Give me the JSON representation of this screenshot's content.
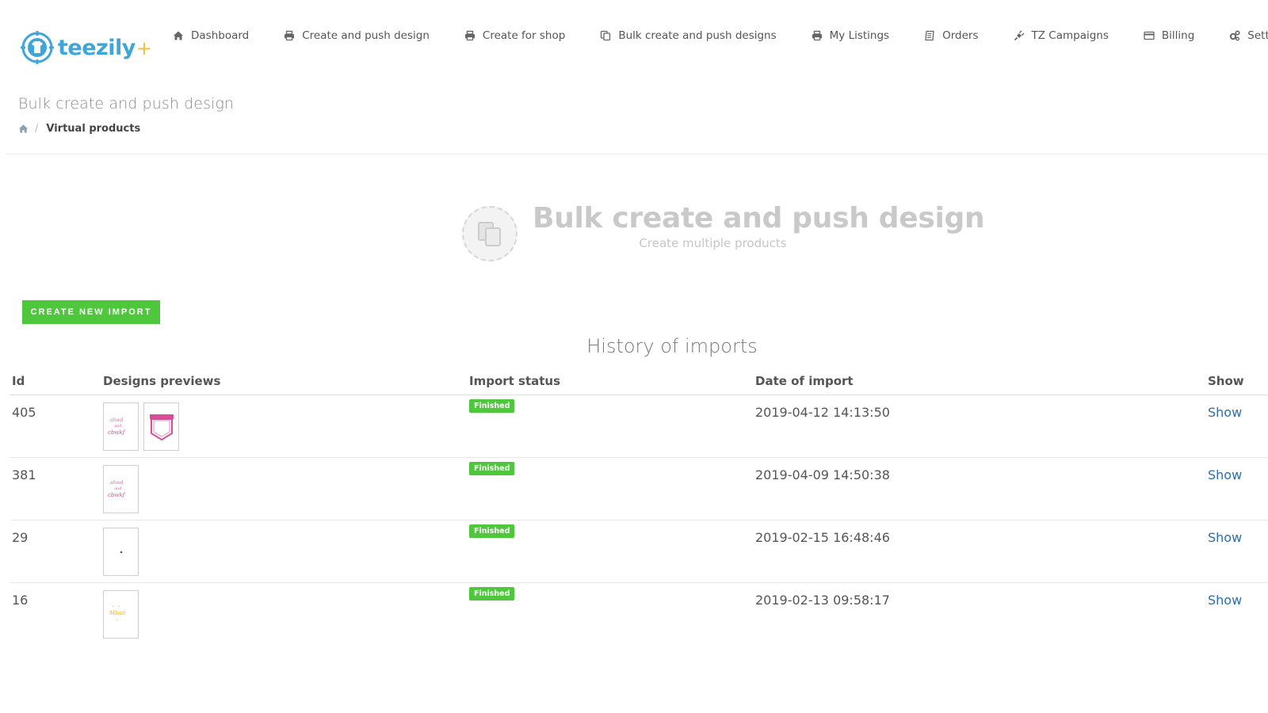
{
  "logo": {
    "text": "teezily",
    "plus": "+"
  },
  "nav": [
    {
      "label": "Dashboard",
      "icon": "home-icon"
    },
    {
      "label": "Create and push design",
      "icon": "printer-icon"
    },
    {
      "label": "Create for shop",
      "icon": "printer-icon"
    },
    {
      "label": "Bulk create and push designs",
      "icon": "copy-icon"
    },
    {
      "label": "My Listings",
      "icon": "printer-icon"
    },
    {
      "label": "Orders",
      "icon": "list-icon"
    },
    {
      "label": "TZ Campaigns",
      "icon": "plug-icon"
    },
    {
      "label": "Billing",
      "icon": "credit-card-icon"
    },
    {
      "label": "Settings",
      "icon": "gears-icon"
    }
  ],
  "page": {
    "title": "Bulk create and push design",
    "breadcrumb_current": "Virtual products"
  },
  "hero": {
    "title": "Bulk create and push design",
    "subtitle": "Create multiple products"
  },
  "actions": {
    "create_import": "CREATE NEW IMPORT"
  },
  "history": {
    "title": "History of imports",
    "columns": [
      "Id",
      "Designs previews",
      "Import status",
      "Date of import",
      "Show"
    ],
    "rows": [
      {
        "id": "405",
        "status": "Finished",
        "date": "2019-04-12 14:13:50",
        "show": "Show",
        "previews": [
          "pink-lettering-design",
          "pink-pocket-design"
        ]
      },
      {
        "id": "381",
        "status": "Finished",
        "date": "2019-04-09 14:50:38",
        "show": "Show",
        "previews": [
          "pink-lettering-design"
        ]
      },
      {
        "id": "29",
        "status": "Finished",
        "date": "2019-02-15 16:48:46",
        "show": "Show",
        "previews": [
          "small-dot-design"
        ]
      },
      {
        "id": "16",
        "status": "Finished",
        "date": "2019-02-13 09:58:17",
        "show": "Show",
        "previews": [
          "yellow-lettering-design"
        ]
      }
    ]
  },
  "colors": {
    "accent_green": "#4fc73d",
    "link_blue": "#2d6fa6",
    "logo_blue": "#3fa6d9",
    "logo_plus_yellow": "#f0c33c"
  }
}
